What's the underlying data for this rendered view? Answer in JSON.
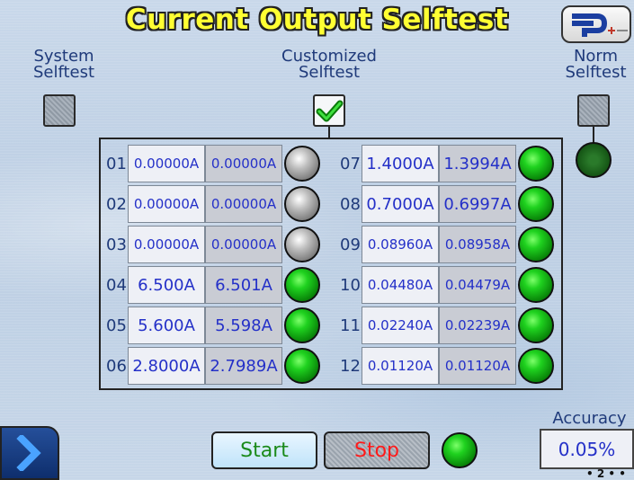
{
  "title": "Current Output Selftest",
  "system": {
    "line1": "System",
    "line2": "Selftest",
    "checked": false
  },
  "customized": {
    "line1": "Customized",
    "line2": "Selftest",
    "checked": true
  },
  "norm": {
    "line1": "Norm",
    "line2": "Selftest",
    "checked": false
  },
  "channels_left": [
    {
      "ch": "01",
      "set": "0.00000A",
      "meas": "0.00000A",
      "status": "gray"
    },
    {
      "ch": "02",
      "set": "0.00000A",
      "meas": "0.00000A",
      "status": "gray"
    },
    {
      "ch": "03",
      "set": "0.00000A",
      "meas": "0.00000A",
      "status": "gray"
    },
    {
      "ch": "04",
      "set": "6.500A",
      "meas": "6.501A",
      "status": "green"
    },
    {
      "ch": "05",
      "set": "5.600A",
      "meas": "5.598A",
      "status": "green"
    },
    {
      "ch": "06",
      "set": "2.8000A",
      "meas": "2.7989A",
      "status": "green"
    }
  ],
  "channels_right": [
    {
      "ch": "07",
      "set": "1.4000A",
      "meas": "1.3994A",
      "status": "green"
    },
    {
      "ch": "08",
      "set": "0.7000A",
      "meas": "0.6997A",
      "status": "green"
    },
    {
      "ch": "09",
      "set": "0.08960A",
      "meas": "0.08958A",
      "status": "green"
    },
    {
      "ch": "10",
      "set": "0.04480A",
      "meas": "0.04479A",
      "status": "green"
    },
    {
      "ch": "11",
      "set": "0.02240A",
      "meas": "0.02239A",
      "status": "green"
    },
    {
      "ch": "12",
      "set": "0.01120A",
      "meas": "0.01120A",
      "status": "green"
    }
  ],
  "buttons": {
    "start": "Start",
    "stop": "Stop"
  },
  "accuracy": {
    "label": "Accuracy",
    "value": "0.05%"
  },
  "page_indicator": "• 2 • •",
  "colors": {
    "title": "#ffff33",
    "start_text": "#1a8a1a",
    "stop_text": "#ff1a1a",
    "value_text": "#2430c8"
  }
}
